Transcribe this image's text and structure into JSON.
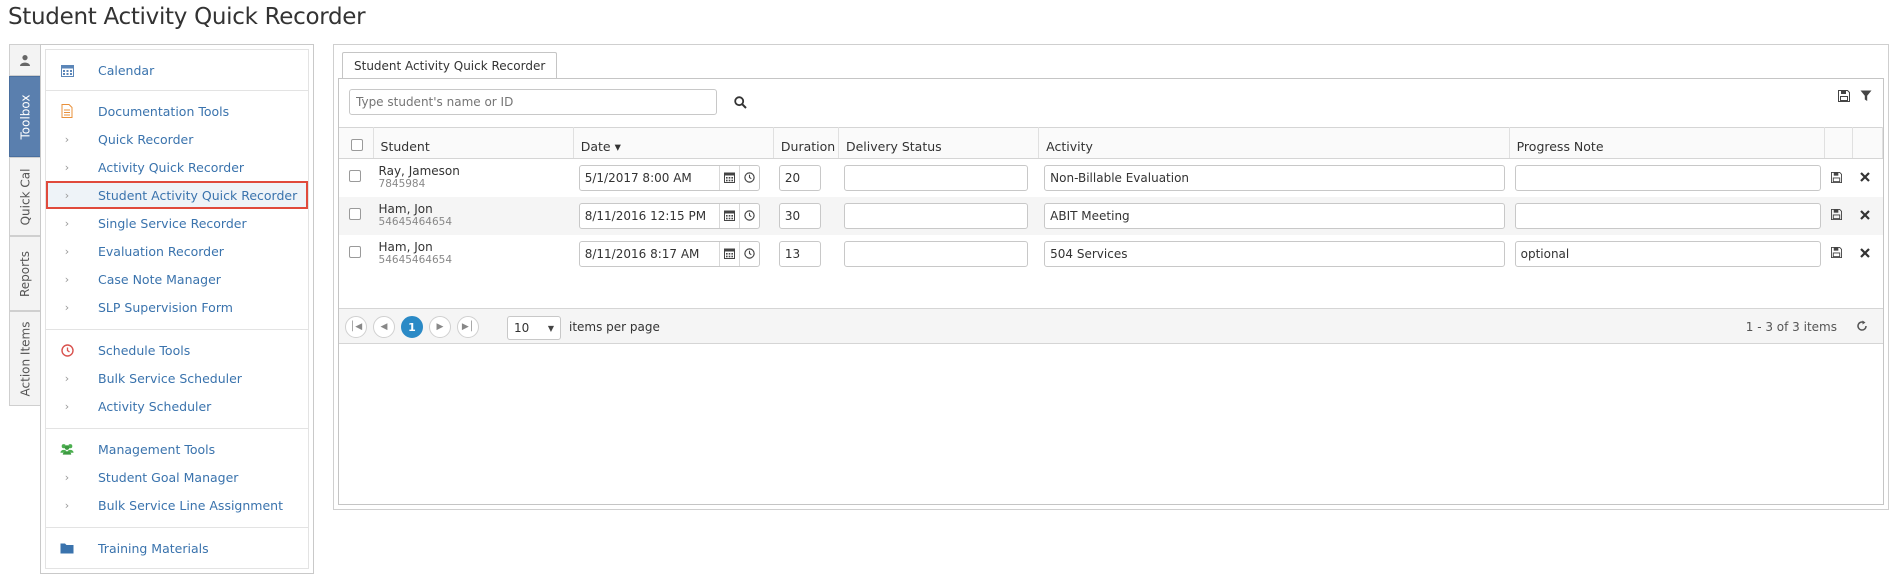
{
  "page": {
    "title": "Student Activity Quick Recorder"
  },
  "vertical_tabs": [
    {
      "label": "",
      "icon": "user-icon",
      "active": false
    },
    {
      "label": "Toolbox",
      "active": true
    },
    {
      "label": "Quick Cal",
      "active": false
    },
    {
      "label": "Reports",
      "active": false
    },
    {
      "label": "Action Items",
      "active": false
    }
  ],
  "sidebar": {
    "calendar": {
      "label": "Calendar",
      "icon": "calendar-icon"
    },
    "documentation": {
      "label": "Documentation Tools",
      "icon": "document-icon",
      "items": [
        "Quick Recorder",
        "Activity Quick Recorder",
        "Student Activity Quick Recorder",
        "Single Service Recorder",
        "Evaluation Recorder",
        "Case Note Manager",
        "SLP Supervision Form"
      ],
      "selected_index": 2
    },
    "schedule": {
      "label": "Schedule Tools",
      "icon": "clock-icon",
      "items": [
        "Bulk Service Scheduler",
        "Activity Scheduler"
      ]
    },
    "management": {
      "label": "Management Tools",
      "icon": "users-icon",
      "items": [
        "Student Goal Manager",
        "Bulk Service Line Assignment"
      ]
    },
    "training": {
      "label": "Training Materials",
      "icon": "folder-icon"
    }
  },
  "main": {
    "tab_label": "Student Activity Quick Recorder",
    "search": {
      "placeholder": "Type student's name or ID",
      "value": ""
    },
    "columns": [
      "Student",
      "Date ▾",
      "Duration",
      "Delivery Status",
      "Activity",
      "Progress Note"
    ],
    "rows": [
      {
        "name": "Ray, Jameson",
        "id": "7845984",
        "date": "5/1/2017 8:00 AM",
        "duration": "20",
        "delivery_status": "",
        "activity": "Non-Billable Evaluation",
        "progress_note": ""
      },
      {
        "name": "Ham, Jon",
        "id": "54645464654",
        "date": "8/11/2016 12:15 PM",
        "duration": "30",
        "delivery_status": "",
        "activity": "ABIT Meeting",
        "progress_note": ""
      },
      {
        "name": "Ham, Jon",
        "id": "54645464654",
        "date": "8/11/2016 8:17 AM",
        "duration": "13",
        "delivery_status": "",
        "activity": "504 Services",
        "progress_note": "optional"
      }
    ],
    "pager": {
      "current_page": "1",
      "page_size": "10",
      "items_per_page_label": "items per page",
      "info": "1 - 3 of 3 items"
    }
  },
  "colors": {
    "link": "#3a73ad",
    "active_tab": "#5a7fae",
    "pager_current": "#2b8ac6",
    "highlight_outline": "#e04a3c"
  }
}
